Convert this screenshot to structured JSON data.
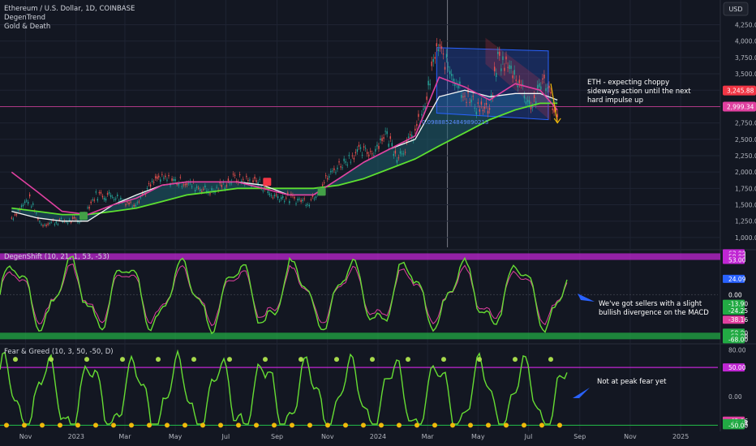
{
  "header": {
    "title": "Ethereum / U.S. Dollar, 1D, COINBASE",
    "indicators": [
      "DegenTrend",
      "Gold & Death"
    ],
    "currency_button": "USD"
  },
  "colors": {
    "background": "#131722",
    "grid": "#1f2433",
    "axis_text": "#b2b5be",
    "pink": "#e040a0",
    "green": "#4caf50",
    "lime": "#66dd33",
    "magenta_band": "#c026d3",
    "blue": "#2962ff",
    "red_label": "#f23645"
  },
  "chart_data": [
    {
      "type": "line",
      "panel": "price",
      "x_axis": {
        "ticks": [
          "Nov",
          "2023",
          "Mar",
          "May",
          "Jul",
          "Sep",
          "Nov",
          "2024",
          "Mar",
          "May",
          "Jul",
          "Sep",
          "Nov",
          "2025"
        ]
      },
      "y_axis": {
        "ticks": [
          "4,250.00",
          "4,000.00",
          "3,750.00",
          "3,500.00",
          "3,250.00",
          "3,000.00",
          "2,750.00",
          "2,500.00",
          "2,250.00",
          "2,000.00",
          "1,750.00",
          "1,500.00",
          "1,250.00",
          "1,000.00"
        ],
        "range": [
          850,
          4380
        ],
        "price_labels": [
          {
            "text": "3,245.88",
            "value": 3245.88,
            "color": "#f23645"
          },
          {
            "text": "2,999.34",
            "value": 2999.34,
            "color": "#e040a0"
          }
        ]
      },
      "series": [
        {
          "role": "price",
          "x": [
            "2022-10-15",
            "2022-11-05",
            "2022-11-20",
            "2022-12-10",
            "2023-01-05",
            "2023-01-25",
            "2023-02-15",
            "2023-03-10",
            "2023-04-10",
            "2023-05-10",
            "2023-06-15",
            "2023-07-10",
            "2023-08-10",
            "2023-08-25",
            "2023-09-15",
            "2023-10-10",
            "2023-10-25",
            "2023-11-10",
            "2023-12-05",
            "2023-12-25",
            "2024-01-10",
            "2024-01-25",
            "2024-02-10",
            "2024-02-25",
            "2024-03-12",
            "2024-04-01",
            "2024-04-20",
            "2024-05-15",
            "2024-05-25",
            "2024-06-15",
            "2024-07-05",
            "2024-07-20",
            "2024-08-05"
          ],
          "y": [
            1300,
            1600,
            1200,
            1250,
            1250,
            1650,
            1650,
            1500,
            1900,
            1850,
            1700,
            1900,
            1850,
            1650,
            1600,
            1550,
            1800,
            2050,
            2300,
            2300,
            2600,
            2250,
            2500,
            2900,
            3900,
            3500,
            3100,
            2900,
            3750,
            3500,
            3000,
            3450,
            2800
          ]
        },
        {
          "role": "pink moving average",
          "x": [
            "2022-10-15",
            "2022-11-15",
            "2022-12-15",
            "2023-01-15",
            "2023-02-15",
            "2023-03-15",
            "2023-04-15",
            "2023-05-15",
            "2023-06-15",
            "2023-07-15",
            "2023-08-15",
            "2023-09-15",
            "2023-10-15",
            "2023-11-15",
            "2023-12-15",
            "2024-01-15",
            "2024-02-15",
            "2024-03-15",
            "2024-04-15",
            "2024-05-15",
            "2024-06-15",
            "2024-07-15",
            "2024-08-05"
          ],
          "y": [
            2000,
            1700,
            1400,
            1350,
            1500,
            1600,
            1800,
            1850,
            1850,
            1850,
            1750,
            1650,
            1650,
            1900,
            2150,
            2350,
            2550,
            3450,
            3300,
            3100,
            3350,
            3250,
            2950
          ]
        },
        {
          "role": "white moving average",
          "x": [
            "2022-10-15",
            "2022-11-15",
            "2022-12-15",
            "2023-01-15",
            "2023-02-15",
            "2023-03-15",
            "2023-04-15",
            "2023-05-15",
            "2023-06-15",
            "2023-07-15",
            "2023-08-15",
            "2023-09-15",
            "2023-10-15",
            "2023-11-15",
            "2023-12-15",
            "2024-01-15",
            "2024-02-15",
            "2024-03-15",
            "2024-04-15",
            "2024-05-15",
            "2024-06-15",
            "2024-07-15",
            "2024-08-05"
          ],
          "y": [
            1400,
            1300,
            1250,
            1250,
            1500,
            1650,
            1800,
            1850,
            1850,
            1850,
            1800,
            1650,
            1650,
            1900,
            2150,
            2350,
            2500,
            3150,
            3250,
            3150,
            3200,
            3200,
            3100
          ]
        },
        {
          "role": "green moving average",
          "x": [
            "2022-10-15",
            "2022-11-15",
            "2022-12-15",
            "2023-01-15",
            "2023-02-15",
            "2023-03-15",
            "2023-04-15",
            "2023-05-15",
            "2023-06-15",
            "2023-07-15",
            "2023-08-15",
            "2023-09-15",
            "2023-10-15",
            "2023-11-15",
            "2023-12-15",
            "2024-01-15",
            "2024-02-15",
            "2024-03-15",
            "2024-04-15",
            "2024-05-15",
            "2024-06-15",
            "2024-07-15",
            "2024-08-05"
          ],
          "y": [
            1450,
            1400,
            1350,
            1350,
            1400,
            1450,
            1550,
            1650,
            1700,
            1750,
            1750,
            1750,
            1750,
            1800,
            1900,
            2050,
            2200,
            2400,
            2600,
            2800,
            2950,
            3050,
            3050
          ]
        }
      ],
      "annotations": [
        {
          "text": "ETH - expecting choppy sideways action until the next hard impulse up"
        },
        {
          "text": "0.09888524849890213"
        }
      ]
    },
    {
      "type": "line",
      "panel": "oscillator",
      "title": "DegenShift (10, 21, 1, 53, -53)",
      "y_axis": {
        "labels": [
          {
            "text": "63.00",
            "value": 63,
            "color": "#c026d3"
          },
          {
            "text": "58.00",
            "value": 58,
            "color": "#c026d3"
          },
          {
            "text": "53.00",
            "value": 53,
            "color": "#c026d3"
          },
          {
            "text": "24.09",
            "value": 24.09,
            "color": "#2962ff"
          },
          {
            "text": "0.00",
            "value": 0,
            "color": "#131722"
          },
          {
            "text": "-13.90",
            "value": -13.9,
            "color": "#22aa44"
          },
          {
            "text": "-24.25",
            "value": -24.25,
            "color": "#22aa44"
          },
          {
            "text": "-38.16",
            "value": -38.16,
            "color": "#e040a0"
          },
          {
            "text": "-58.00",
            "value": -58,
            "color": "#22aa44"
          },
          {
            "text": "-63.00",
            "value": -63,
            "color": "#22aa44"
          },
          {
            "text": "-68.00",
            "value": -68,
            "color": "#22aa44"
          }
        ]
      },
      "annotations": [
        {
          "text": "We've got sellers with a slight bullish divergence on the MACD"
        }
      ]
    },
    {
      "type": "line",
      "panel": "oscillator",
      "title": "Fear & Greed (10, 3, 50, -50, D)",
      "y_axis": {
        "labels": [
          {
            "text": "80.00",
            "value": 80,
            "color": null
          },
          {
            "text": "50.00",
            "value": 50,
            "color": "#c026d3"
          },
          {
            "text": "0.00",
            "value": 0,
            "color": null
          },
          {
            "text": "-42.06",
            "value": -42.06,
            "color": "#e040a0"
          },
          {
            "text": "-46.44",
            "value": -46.44,
            "color": "#22aa44"
          },
          {
            "text": "-50.00",
            "value": -50,
            "color": "#22aa44"
          }
        ]
      },
      "annotations": [
        {
          "text": "Not at peak fear yet"
        }
      ]
    }
  ]
}
